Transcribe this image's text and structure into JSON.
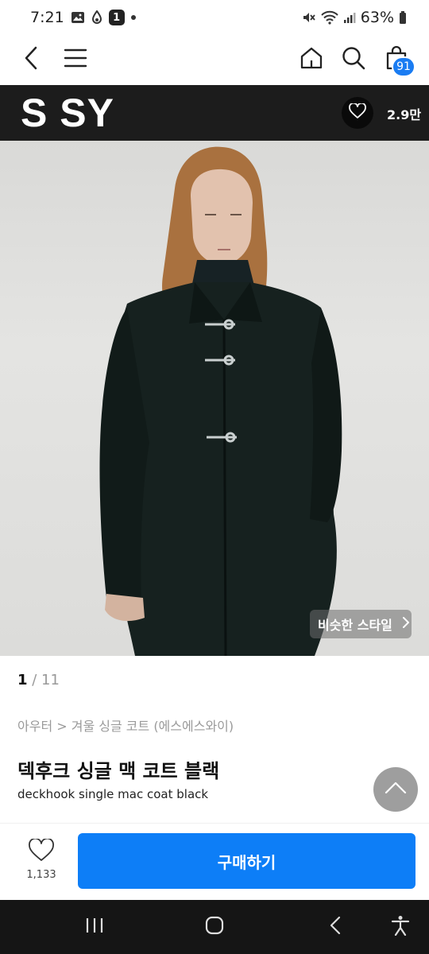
{
  "status_bar": {
    "time": "7:21",
    "notification_badge": "1",
    "battery": "63%"
  },
  "brand": {
    "logo": "S SY",
    "follower_count": "2.9만"
  },
  "cart": {
    "count": "91"
  },
  "gallery": {
    "current": "1",
    "separator": " / ",
    "total": "11",
    "similar_label": "비슷한 스타일"
  },
  "product": {
    "breadcrumb": "아우터 > 겨울 싱글 코트 (에스에스와이)",
    "title_ko": "덱후크 싱글 맥 코트 블랙",
    "title_en": "deckhook single mac coat black"
  },
  "actions": {
    "like_count": "1,133",
    "buy_label": "구매하기"
  },
  "colors": {
    "accent": "#0d7ef7",
    "cart_badge": "#1a7cf2",
    "brand_bar": "#1c1c1c"
  },
  "icons": [
    "back-icon",
    "menu-icon",
    "home-icon",
    "search-icon",
    "cart-icon",
    "heart-icon",
    "chevron-right-icon",
    "chevron-up-icon",
    "recent-apps-icon",
    "home-nav-icon",
    "back-nav-icon",
    "accessibility-icon"
  ]
}
